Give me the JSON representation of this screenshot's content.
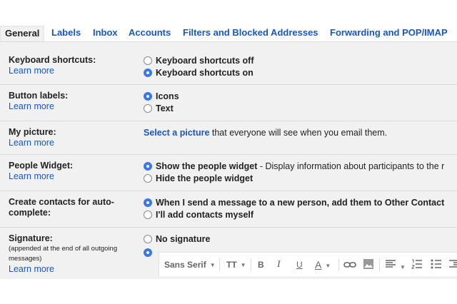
{
  "tabs": [
    "General",
    "Labels",
    "Inbox",
    "Accounts",
    "Filters and Blocked Addresses",
    "Forwarding and POP/IMAP"
  ],
  "learn_more": "Learn more",
  "shortcuts": {
    "label": "Keyboard shortcuts:",
    "options": [
      "Keyboard shortcuts off",
      "Keyboard shortcuts on"
    ],
    "selected": 1
  },
  "button_labels": {
    "label": "Button labels:",
    "options": [
      "Icons",
      "Text"
    ],
    "selected": 0
  },
  "picture": {
    "label": "My picture:",
    "link": "Select a picture",
    "text": " that everyone will see when you email them."
  },
  "people_widget": {
    "label": "People Widget:",
    "option1_bold": "Show the people widget",
    "option1_rest": " - Display information about participants to the r",
    "option2": "Hide the people widget",
    "selected": 0
  },
  "contacts": {
    "label": "Create contacts for auto-complete:",
    "option1": "When I send a message to a new person, add them to Other Contact",
    "option2": "I'll add contacts myself",
    "selected": 0
  },
  "signature": {
    "label": "Signature:",
    "sub": "(appended at the end of all outgoing messages)",
    "option1": "No signature",
    "selected": 1
  },
  "toolbar": {
    "font": "Sans Serif",
    "size_icon": "TT",
    "bold": "B",
    "italic": "I",
    "underline": "U",
    "color": "A"
  },
  "colors": {
    "link": "#1a56bd",
    "panel": "#f1f1f1",
    "radio_on": "#3b78e7"
  }
}
